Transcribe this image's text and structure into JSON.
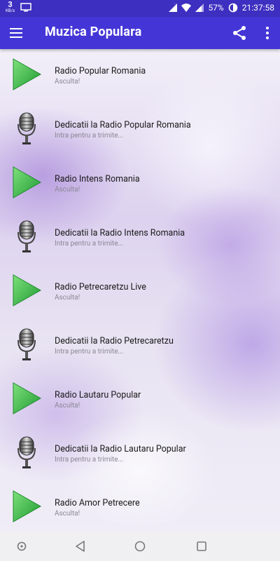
{
  "status_bar": {
    "net_speed_value": "3",
    "net_speed_unit": "KB/s",
    "battery_percent": "57%",
    "time": "21:37:58"
  },
  "app_bar": {
    "title": "Muzica Populara",
    "background": "#4436d6"
  },
  "items": [
    {
      "icon": "play-icon",
      "title": "Radio Popular Romania",
      "subtitle": "Asculta!"
    },
    {
      "icon": "microphone-icon",
      "title": "Dedicatii la Radio Popular Romania",
      "subtitle": "Intra pentru a trimite..."
    },
    {
      "icon": "play-icon",
      "title": "Radio Intens Romania",
      "subtitle": "Asculta!"
    },
    {
      "icon": "microphone-icon",
      "title": "Dedicatii la Radio Intens Romania",
      "subtitle": "Intra pentru a trimite..."
    },
    {
      "icon": "play-icon",
      "title": "Radio Petrecaretzu Live",
      "subtitle": "Asculta!"
    },
    {
      "icon": "microphone-icon",
      "title": "Dedicatii la Radio Petrecaretzu",
      "subtitle": "Intra pentru a trimite..."
    },
    {
      "icon": "play-icon",
      "title": "Radio Lautaru Popular",
      "subtitle": "Asculta!"
    },
    {
      "icon": "microphone-icon",
      "title": "Dedicatii la Radio Lautaru Popular",
      "subtitle": "Intra pentru a trimite..."
    },
    {
      "icon": "play-icon",
      "title": "Radio Amor Petrecere",
      "subtitle": "Asculta!"
    }
  ]
}
